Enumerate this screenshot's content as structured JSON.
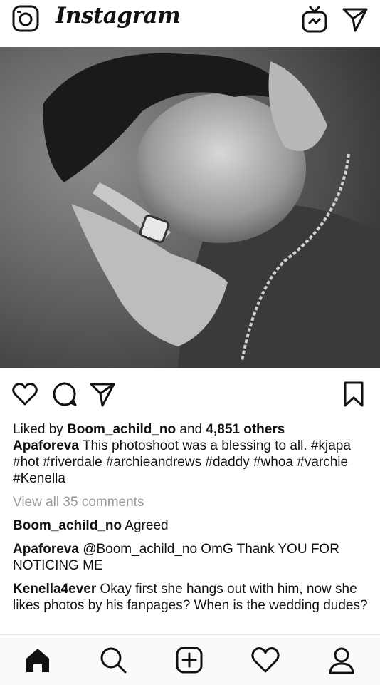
{
  "app": {
    "name": "Instagram"
  },
  "header": {
    "icons": [
      "camera-icon",
      "igtv-icon",
      "send-icon"
    ]
  },
  "post": {
    "image_alt": "",
    "actions": [
      "heart-icon",
      "comment-icon",
      "share-icon",
      "bookmark-icon"
    ],
    "likes": {
      "prefix": "Liked by",
      "user": "Boom_achild_no",
      "joiner": "and",
      "count_text": "4,851 others"
    },
    "caption": {
      "author": "Apaforeva",
      "text": " This photoshoot was a blessing to all. #kjapa #hot #riverdale #archieandrews #daddy #whoa #varchie #Kenella"
    },
    "view_comments": "View all 35 comments",
    "comments": [
      {
        "user": "Boom_achild_no",
        "text": " Agreed"
      },
      {
        "user": "Apaforeva",
        "text": " @Boom_achild_no OmG Thank YOU FOR NOTICING ME"
      },
      {
        "user": "Kenella4ever",
        "text": " Okay first she hangs out with him, now she likes photos by his fanpages? When is the wedding dudes?"
      }
    ]
  },
  "bottom_nav": {
    "items": [
      "home-icon",
      "search-icon",
      "add-icon",
      "activity-icon",
      "profile-icon"
    ]
  }
}
